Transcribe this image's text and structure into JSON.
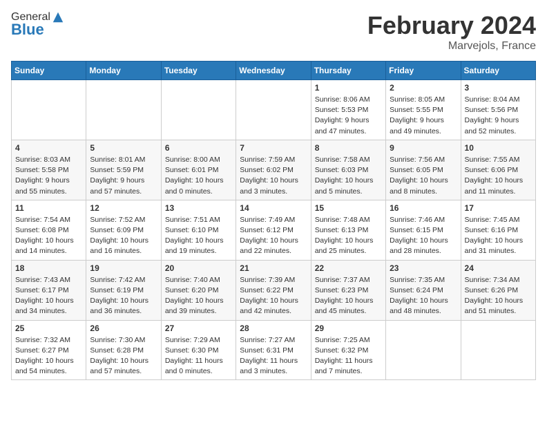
{
  "header": {
    "logo_line1": "General",
    "logo_line2": "Blue",
    "month": "February 2024",
    "location": "Marvejols, France"
  },
  "days_of_week": [
    "Sunday",
    "Monday",
    "Tuesday",
    "Wednesday",
    "Thursday",
    "Friday",
    "Saturday"
  ],
  "weeks": [
    [
      {
        "num": "",
        "info": ""
      },
      {
        "num": "",
        "info": ""
      },
      {
        "num": "",
        "info": ""
      },
      {
        "num": "",
        "info": ""
      },
      {
        "num": "1",
        "info": "Sunrise: 8:06 AM\nSunset: 5:53 PM\nDaylight: 9 hours\nand 47 minutes."
      },
      {
        "num": "2",
        "info": "Sunrise: 8:05 AM\nSunset: 5:55 PM\nDaylight: 9 hours\nand 49 minutes."
      },
      {
        "num": "3",
        "info": "Sunrise: 8:04 AM\nSunset: 5:56 PM\nDaylight: 9 hours\nand 52 minutes."
      }
    ],
    [
      {
        "num": "4",
        "info": "Sunrise: 8:03 AM\nSunset: 5:58 PM\nDaylight: 9 hours\nand 55 minutes."
      },
      {
        "num": "5",
        "info": "Sunrise: 8:01 AM\nSunset: 5:59 PM\nDaylight: 9 hours\nand 57 minutes."
      },
      {
        "num": "6",
        "info": "Sunrise: 8:00 AM\nSunset: 6:01 PM\nDaylight: 10 hours\nand 0 minutes."
      },
      {
        "num": "7",
        "info": "Sunrise: 7:59 AM\nSunset: 6:02 PM\nDaylight: 10 hours\nand 3 minutes."
      },
      {
        "num": "8",
        "info": "Sunrise: 7:58 AM\nSunset: 6:03 PM\nDaylight: 10 hours\nand 5 minutes."
      },
      {
        "num": "9",
        "info": "Sunrise: 7:56 AM\nSunset: 6:05 PM\nDaylight: 10 hours\nand 8 minutes."
      },
      {
        "num": "10",
        "info": "Sunrise: 7:55 AM\nSunset: 6:06 PM\nDaylight: 10 hours\nand 11 minutes."
      }
    ],
    [
      {
        "num": "11",
        "info": "Sunrise: 7:54 AM\nSunset: 6:08 PM\nDaylight: 10 hours\nand 14 minutes."
      },
      {
        "num": "12",
        "info": "Sunrise: 7:52 AM\nSunset: 6:09 PM\nDaylight: 10 hours\nand 16 minutes."
      },
      {
        "num": "13",
        "info": "Sunrise: 7:51 AM\nSunset: 6:10 PM\nDaylight: 10 hours\nand 19 minutes."
      },
      {
        "num": "14",
        "info": "Sunrise: 7:49 AM\nSunset: 6:12 PM\nDaylight: 10 hours\nand 22 minutes."
      },
      {
        "num": "15",
        "info": "Sunrise: 7:48 AM\nSunset: 6:13 PM\nDaylight: 10 hours\nand 25 minutes."
      },
      {
        "num": "16",
        "info": "Sunrise: 7:46 AM\nSunset: 6:15 PM\nDaylight: 10 hours\nand 28 minutes."
      },
      {
        "num": "17",
        "info": "Sunrise: 7:45 AM\nSunset: 6:16 PM\nDaylight: 10 hours\nand 31 minutes."
      }
    ],
    [
      {
        "num": "18",
        "info": "Sunrise: 7:43 AM\nSunset: 6:17 PM\nDaylight: 10 hours\nand 34 minutes."
      },
      {
        "num": "19",
        "info": "Sunrise: 7:42 AM\nSunset: 6:19 PM\nDaylight: 10 hours\nand 36 minutes."
      },
      {
        "num": "20",
        "info": "Sunrise: 7:40 AM\nSunset: 6:20 PM\nDaylight: 10 hours\nand 39 minutes."
      },
      {
        "num": "21",
        "info": "Sunrise: 7:39 AM\nSunset: 6:22 PM\nDaylight: 10 hours\nand 42 minutes."
      },
      {
        "num": "22",
        "info": "Sunrise: 7:37 AM\nSunset: 6:23 PM\nDaylight: 10 hours\nand 45 minutes."
      },
      {
        "num": "23",
        "info": "Sunrise: 7:35 AM\nSunset: 6:24 PM\nDaylight: 10 hours\nand 48 minutes."
      },
      {
        "num": "24",
        "info": "Sunrise: 7:34 AM\nSunset: 6:26 PM\nDaylight: 10 hours\nand 51 minutes."
      }
    ],
    [
      {
        "num": "25",
        "info": "Sunrise: 7:32 AM\nSunset: 6:27 PM\nDaylight: 10 hours\nand 54 minutes."
      },
      {
        "num": "26",
        "info": "Sunrise: 7:30 AM\nSunset: 6:28 PM\nDaylight: 10 hours\nand 57 minutes."
      },
      {
        "num": "27",
        "info": "Sunrise: 7:29 AM\nSunset: 6:30 PM\nDaylight: 11 hours\nand 0 minutes."
      },
      {
        "num": "28",
        "info": "Sunrise: 7:27 AM\nSunset: 6:31 PM\nDaylight: 11 hours\nand 3 minutes."
      },
      {
        "num": "29",
        "info": "Sunrise: 7:25 AM\nSunset: 6:32 PM\nDaylight: 11 hours\nand 7 minutes."
      },
      {
        "num": "",
        "info": ""
      },
      {
        "num": "",
        "info": ""
      }
    ]
  ]
}
